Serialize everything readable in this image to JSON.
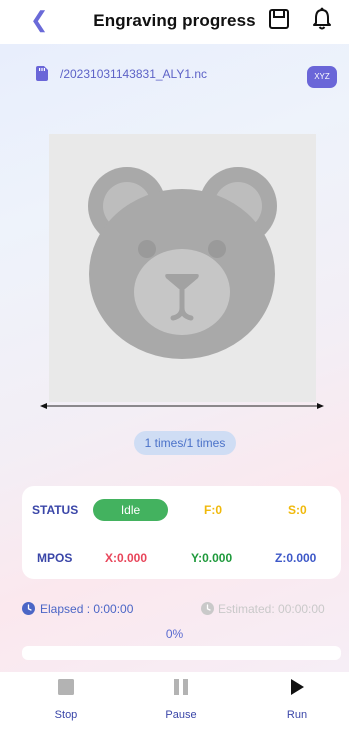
{
  "header": {
    "back_icon": "chevron-left-icon",
    "title": "Engraving progress",
    "save_icon": "save-icon",
    "bell_icon": "bell-icon"
  },
  "file": {
    "icon": "sd-card-icon",
    "name": "/20231031143831_ALY1.nc",
    "coord_badge": "XYZ"
  },
  "preview": {
    "image": "bear-face-engraving-preview"
  },
  "repeat": {
    "label": "1 times/1 times"
  },
  "status": {
    "status_label": "STATUS",
    "state": "Idle",
    "f_value": "F:0",
    "s_value": "S:0",
    "mpos_label": "MPOS",
    "x_value": "X:0.000",
    "y_value": "Y:0.000",
    "z_value": "Z:0.000"
  },
  "timing": {
    "elapsed": "Elapsed : 0:00:00",
    "estimated": "Estimated: 00:00:00"
  },
  "progress": {
    "percent_text": "0%",
    "value": 0
  },
  "bottom_bar": {
    "stop": "Stop",
    "pause": "Pause",
    "run": "Run"
  },
  "colors": {
    "accent": "#6a66d8",
    "status_idle": "#43b25f",
    "label_blue": "#3a46a8",
    "x_red": "#e8455a",
    "y_green": "#1f9a3c",
    "z_blue": "#3d58c8",
    "fs_yellow": "#f0b90b"
  }
}
